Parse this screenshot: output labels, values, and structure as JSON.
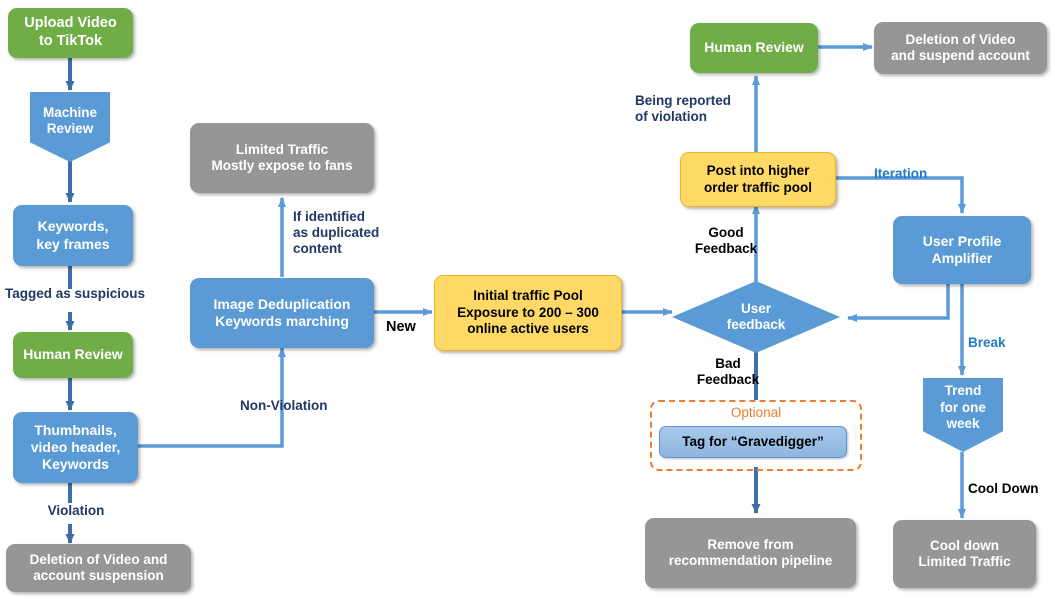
{
  "diagram": {
    "title": "TikTok video moderation and traffic pool flowchart",
    "colors": {
      "green": "#70AD47",
      "blue": "#5B9BD5",
      "gray": "#969696",
      "amber": "#FFD966",
      "arrow": "#5B9BD5",
      "arrow_dark": "#3E6FA8",
      "label_dark": "#1F3864",
      "label_blue": "#1F7AC7",
      "optional_orange": "#ED7D31"
    }
  },
  "nodes": {
    "upload_video": "Upload Video\nto TikTok",
    "machine_review": "Machine\nReview",
    "keywords_key_frames": "Keywords,\nkey frames",
    "human_review_left": "Human Review",
    "thumbnails": "Thumbnails,\nvideo header,\nKeywords",
    "deletion_suspension": "Deletion of Video and\naccount suspension",
    "limited_traffic": "Limited Traffic\nMostly expose to fans",
    "image_dedup": "Image Deduplication\nKeywords marching",
    "initial_traffic_pool": "Initial traffic Pool\nExposure to 200 – 300\nonline active users",
    "user_feedback": "User\nfeedback",
    "post_higher_pool": "Post into higher\norder traffic pool",
    "human_review_top": "Human Review",
    "deletion_suspend_top": "Deletion of Video\nand suspend account",
    "user_profile_amplifier": "User Profile\nAmplifier",
    "trend_one_week": "Trend\nfor one\nweek",
    "cool_down_limited": "Cool down\nLimited Traffic",
    "optional_title": "Optional",
    "tag_gravedigger": "Tag for “Gravedigger”",
    "remove_recommendation": "Remove from\nrecommendation pipeline"
  },
  "edge_labels": {
    "tagged_as_suspicious": "Tagged as suspicious",
    "violation": "Violation",
    "non_violation": "Non-Violation",
    "if_identified_duplicated": "If identified\nas duplicated\ncontent",
    "new": "New",
    "good_feedback": "Good\nFeedback",
    "bad_feedback": "Bad\nFeedback",
    "being_reported": "Being reported\nof violation",
    "iteration": "Iteration",
    "break": "Break",
    "cool_down": "Cool Down"
  }
}
